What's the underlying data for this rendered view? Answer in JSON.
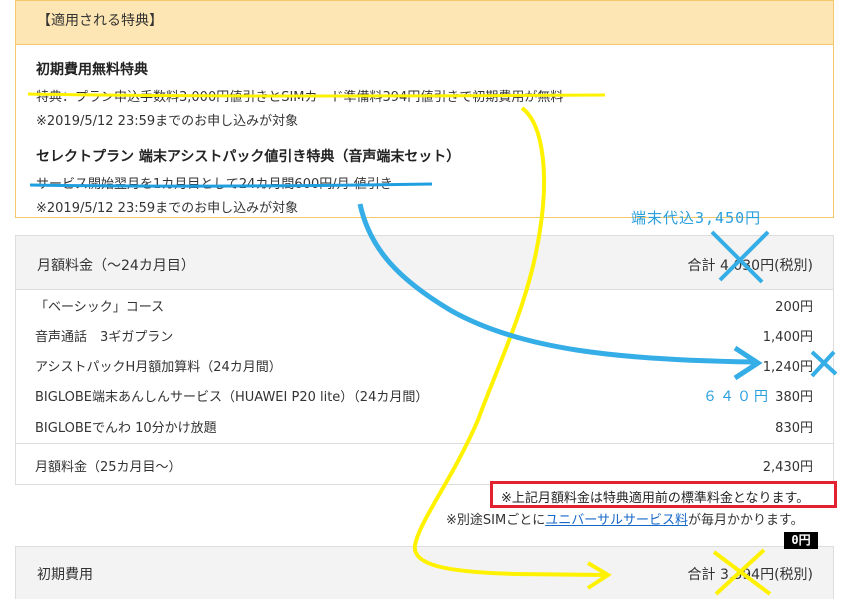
{
  "benefits": {
    "header": "【適用される特典】",
    "items": [
      {
        "title": "初期費用無料特典",
        "desc": "特典：プラン申込手数料3,000円値引きとSIMカード準備料394円値引きで初期費用が無料",
        "note": "※2019/5/12 23:59までのお申し込みが対象"
      },
      {
        "title": "セレクトプラン 端末アシストパック値引き特典（音声端末セット）",
        "desc": "サービス開始翌月を1カ月目として24カ月間600円/月 値引き",
        "note": "※2019/5/12 23:59までのお申し込みが対象"
      }
    ]
  },
  "monthly": {
    "title": "月額料金（～24カ月目）",
    "total": "合計 4,030円(税別)",
    "rows": [
      {
        "label": "「ベーシック」コース",
        "price": "200円"
      },
      {
        "label": "音声通話　3ギガプラン",
        "price": "1,400円"
      },
      {
        "label": "アシストパックH月額加算料（24カ月間）",
        "price": "1,240円"
      },
      {
        "label": "BIGLOBE端末あんしんサービス（HUAWEI P20 lite）（24カ月間）",
        "price": "380円"
      },
      {
        "label": "BIGLOBEでんわ 10分かけ放題",
        "price": "830円"
      }
    ],
    "after": {
      "label": "月額料金（25カ月目～）",
      "price": "2,430円"
    }
  },
  "notice": "※上記月額料金は特典適用前の標準料金となります。",
  "usf": {
    "prefix": "※別途SIMごとに",
    "link": "ユニバーサルサービス料",
    "suffix": "が毎月かかります。"
  },
  "initial": {
    "title": "初期費用",
    "total": "合計 3,394円(税別)"
  },
  "annotations": {
    "device_included": "端末代込3,450円",
    "discounted": "６４０円",
    "zero": "0円",
    "colors": {
      "yellow": "#fff200",
      "blue": "#35ade6",
      "red": "#e4212e"
    }
  }
}
